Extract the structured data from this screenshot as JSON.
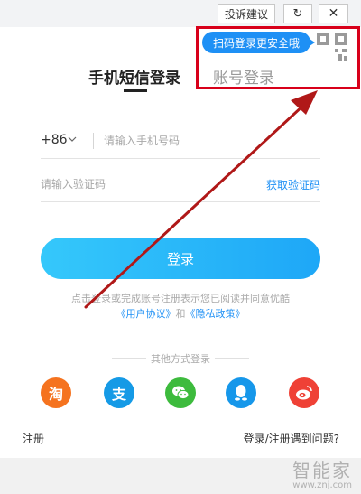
{
  "topbar": {
    "feedback_label": "投诉建议",
    "refresh_glyph": "↻",
    "close_glyph": "✕"
  },
  "qr": {
    "tip": "扫码登录更安全哦"
  },
  "tabs": {
    "sms": "手机短信登录",
    "account": "账号登录"
  },
  "phone": {
    "country_code": "+86",
    "placeholder": "请输入手机号码"
  },
  "code": {
    "placeholder": "请输入验证码",
    "get_code": "获取验证码"
  },
  "login_label": "登录",
  "agreement": {
    "line1": "点击登录或完成账号注册表示您已阅读并同意优酷",
    "user_agreement": "《用户协议》",
    "and": "和",
    "privacy_policy": "《隐私政策》"
  },
  "other_methods": "其他方式登录",
  "social": {
    "taobao": "淘",
    "alipay": "支",
    "wechat": "微",
    "qq": "Q",
    "weibo": "微"
  },
  "footer": {
    "register": "注册",
    "problem": "登录/注册遇到问题?"
  },
  "watermark": {
    "brand": "智能家",
    "url": "www.znj.com"
  },
  "colors": {
    "accent": "#1e90f5",
    "annotation": "#d8001a",
    "arrow": "#b01818"
  },
  "icons": [
    "refresh-icon",
    "close-icon",
    "qr-code-icon",
    "chevron-down-icon",
    "taobao-icon",
    "alipay-icon",
    "wechat-icon",
    "qq-icon",
    "weibo-icon"
  ]
}
